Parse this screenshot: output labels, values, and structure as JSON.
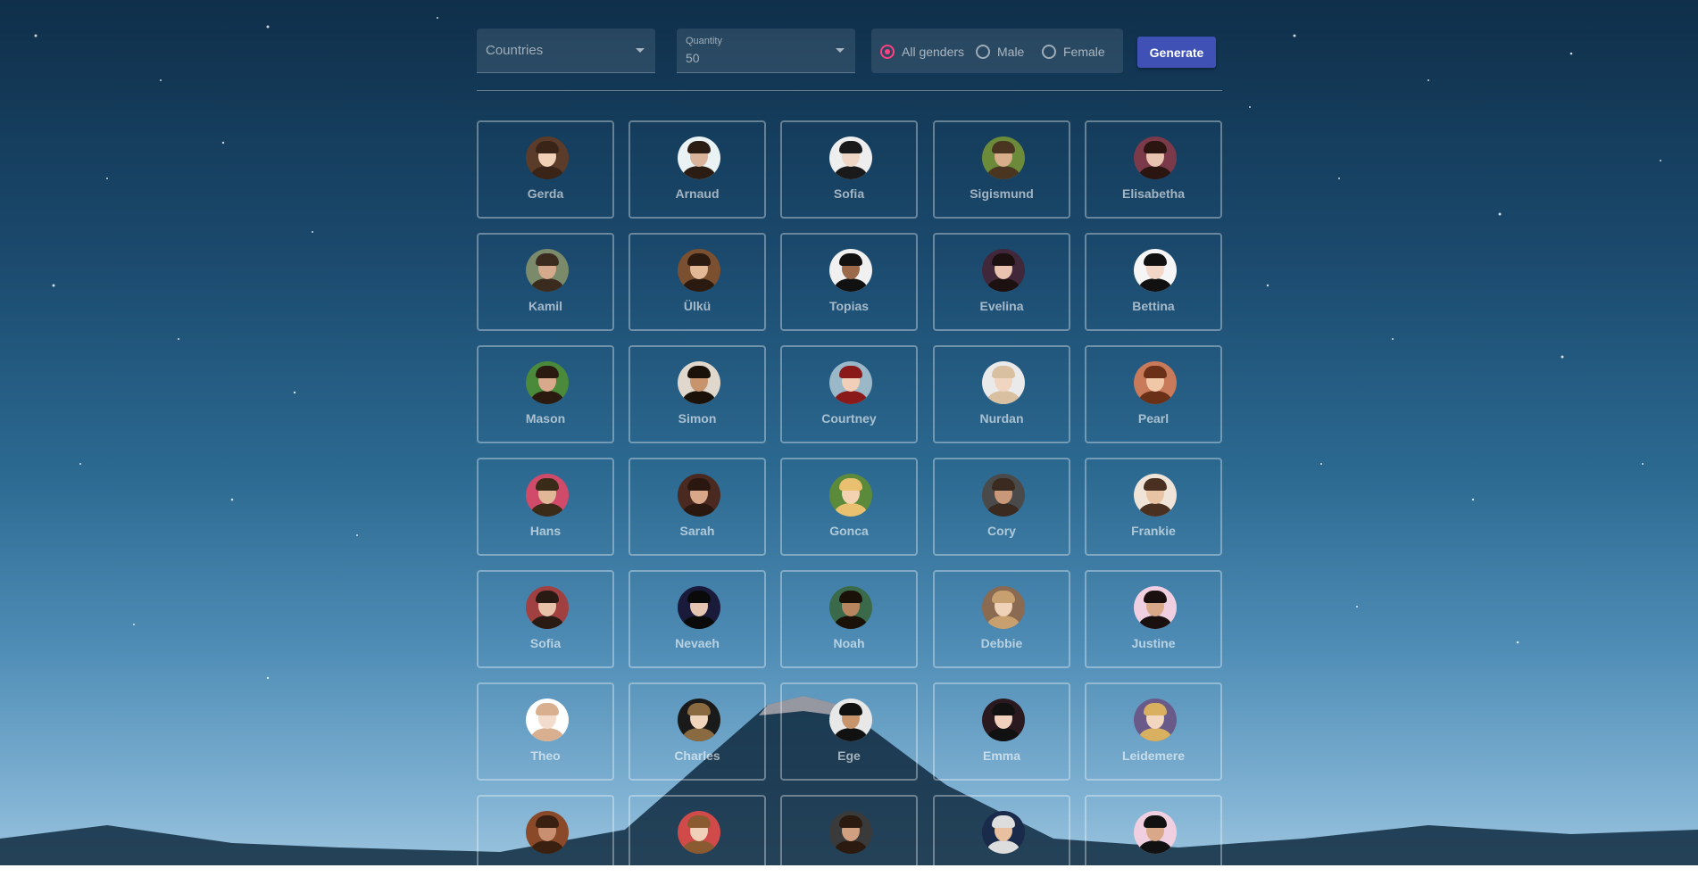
{
  "toolbar": {
    "countries_placeholder": "Countries",
    "quantity_label": "Quantity",
    "quantity_value": "50",
    "gender_options": [
      "All genders",
      "Male",
      "Female"
    ],
    "gender_selected": "All genders",
    "generate_label": "Generate"
  },
  "colors": {
    "accent": "#ff4081",
    "button": "#3f51b5"
  },
  "users": [
    {
      "name": "Gerda"
    },
    {
      "name": "Arnaud"
    },
    {
      "name": "Sofia"
    },
    {
      "name": "Sigismund"
    },
    {
      "name": "Elisabetha"
    },
    {
      "name": "Kamil"
    },
    {
      "name": "Ülkü"
    },
    {
      "name": "Topias"
    },
    {
      "name": "Evelina"
    },
    {
      "name": "Bettina"
    },
    {
      "name": "Mason"
    },
    {
      "name": "Simon"
    },
    {
      "name": "Courtney"
    },
    {
      "name": "Nurdan"
    },
    {
      "name": "Pearl"
    },
    {
      "name": "Hans"
    },
    {
      "name": "Sarah"
    },
    {
      "name": "Gonca"
    },
    {
      "name": "Cory"
    },
    {
      "name": "Frankie"
    },
    {
      "name": "Sofia"
    },
    {
      "name": "Nevaeh"
    },
    {
      "name": "Noah"
    },
    {
      "name": "Debbie"
    },
    {
      "name": "Justine"
    },
    {
      "name": "Theo"
    },
    {
      "name": "Charles"
    },
    {
      "name": "Ege"
    },
    {
      "name": "Emma"
    },
    {
      "name": "Leidemere"
    },
    {
      "name": ""
    },
    {
      "name": ""
    },
    {
      "name": ""
    },
    {
      "name": ""
    },
    {
      "name": ""
    }
  ]
}
